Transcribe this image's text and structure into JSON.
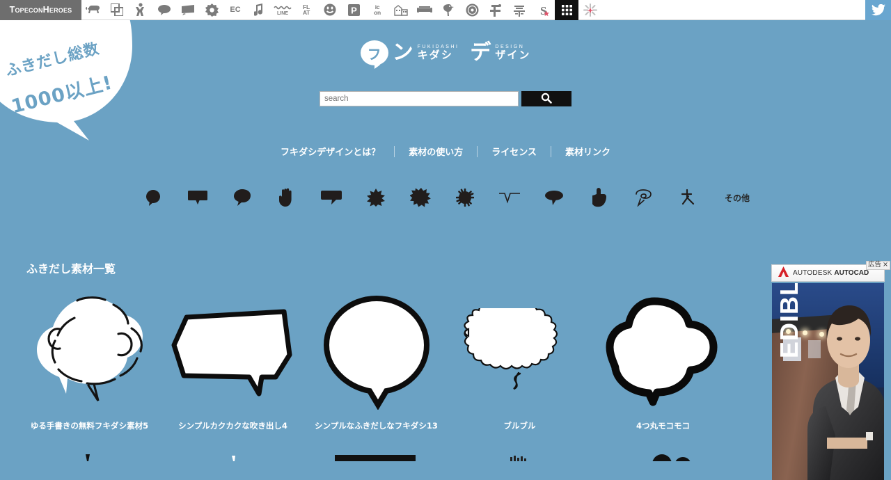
{
  "topbar": {
    "brand_label": "TopeconHeroes",
    "icons": [
      {
        "name": "sheep-icon",
        "label": ""
      },
      {
        "name": "copy-icon",
        "label": ""
      },
      {
        "name": "person-icon",
        "label": ""
      },
      {
        "name": "bubble-round-icon",
        "label": ""
      },
      {
        "name": "bubble-flag-icon",
        "label": ""
      },
      {
        "name": "flower-icon",
        "label": ""
      },
      {
        "name": "ec-icon",
        "label": "EC"
      },
      {
        "name": "music-note-icon",
        "label": ""
      },
      {
        "name": "line-icon",
        "label": "LINE"
      },
      {
        "name": "flat-icon",
        "label": "FL AT"
      },
      {
        "name": "smiley-icon",
        "label": ""
      },
      {
        "name": "parking-icon",
        "label": "P"
      },
      {
        "name": "icon-icon",
        "label": "ic on"
      },
      {
        "name": "building-icon",
        "label": ""
      },
      {
        "name": "sofa-icon",
        "label": ""
      },
      {
        "name": "bird-icon",
        "label": ""
      },
      {
        "name": "gear-ball-icon",
        "label": ""
      },
      {
        "name": "dot-kanji-icon",
        "label": ""
      },
      {
        "name": "brush-kanji-icon",
        "label": ""
      },
      {
        "name": "s-star-icon",
        "label": ""
      },
      {
        "name": "grid-icon",
        "label": ""
      },
      {
        "name": "sparkle-icon",
        "label": ""
      }
    ],
    "twitter_label": "twitter-icon"
  },
  "badge": {
    "line1": "ふきだし総数",
    "line2": "1000以上!"
  },
  "logo": {
    "mark": "フ",
    "kana1": "ン",
    "romaji1": "FUKIDASHI",
    "sub1": "キダシ",
    "kana2": "デ",
    "romaji2": "DESIGN",
    "sub2": "ザイン"
  },
  "search": {
    "value": "",
    "placeholder": "search",
    "button_icon": "search-icon"
  },
  "nav": {
    "items": [
      {
        "label": "フキダシデザインとは？"
      },
      {
        "label": "素材の使い方"
      },
      {
        "label": "ライセンス"
      },
      {
        "label": "素材リンク"
      }
    ]
  },
  "categories": {
    "icons": [
      {
        "name": "category-round-bubble"
      },
      {
        "name": "category-rect-bubble"
      },
      {
        "name": "category-blob-bubble"
      },
      {
        "name": "category-hand-bubble"
      },
      {
        "name": "category-wide-bubble"
      },
      {
        "name": "category-small-burst-bubble"
      },
      {
        "name": "category-burst-bubble"
      },
      {
        "name": "category-spiky-bubble"
      },
      {
        "name": "category-line-bubble"
      },
      {
        "name": "category-oval-bubble"
      },
      {
        "name": "category-thumbsup-bubble"
      },
      {
        "name": "category-swirl-bubble"
      },
      {
        "name": "category-cross-bubble"
      }
    ],
    "other_label": "その他"
  },
  "section": {
    "title": "ふきだし素材一覧"
  },
  "grid": {
    "items": [
      {
        "name": "sketch-cloud-bubble",
        "caption": "ゆる手書きの無料フキダシ素材5"
      },
      {
        "name": "angular-bubble",
        "caption": "シンプルカクカクな吹き出し4"
      },
      {
        "name": "simple-round-bubble",
        "caption": "シンプルなふきだしなフキダシ13"
      },
      {
        "name": "wavy-bubble",
        "caption": "ブルブル"
      },
      {
        "name": "four-lobe-cloud-bubble",
        "caption": "4つ丸モコモコ"
      }
    ]
  },
  "ad": {
    "label": "広告",
    "close": "×",
    "brand_prefix": "AUTODESK",
    "brand_name": "AUTOCAD",
    "headline": "EDIBLE"
  },
  "colors": {
    "page_background": "#6ba2c4",
    "topbar_background": "#ffffff",
    "brand_chip": "#6e6e6e",
    "search_button": "#111111",
    "twitter_blue": "#69a6d0",
    "outline_black": "#111111",
    "bubble_fill": "#ffffff"
  }
}
